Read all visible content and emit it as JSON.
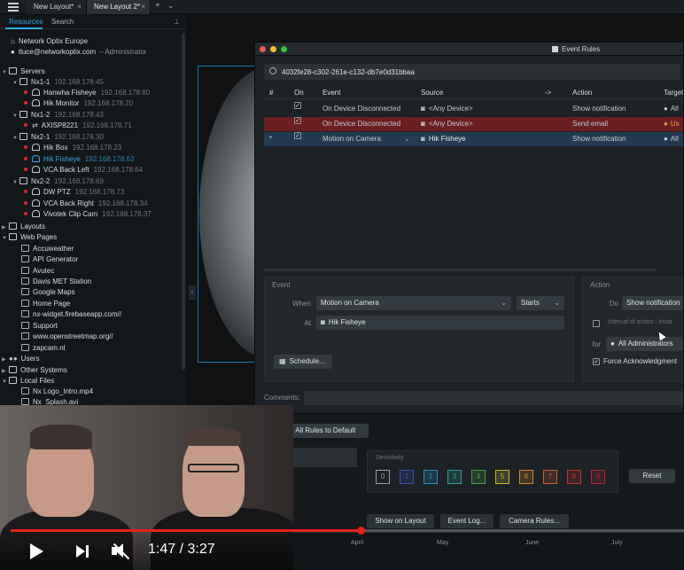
{
  "topbar": {
    "tabs": [
      {
        "label": "New Layout*"
      },
      {
        "label": "New Layout 2*"
      }
    ],
    "plus": "+",
    "chevron": "⌄",
    "close": "×"
  },
  "left_panel": {
    "tab_resources": "Resources",
    "tab_search": "Search",
    "system_name": "Network Optix Europe",
    "user_email": "tluce@networkoptix.com",
    "user_role": "– Administrator",
    "servers_label": "Servers",
    "tree": [
      {
        "name": "Nx1-1",
        "ip": "192.168.178.45"
      },
      {
        "name": "Hanwha Fisheye",
        "ip": "192.168.178.80"
      },
      {
        "name": "Hik Monitor",
        "ip": "192.168.178.20"
      },
      {
        "name": "Nx1-2",
        "ip": "192.168.178.43"
      },
      {
        "name": "AXISP8221",
        "ip": "192.168.178.71"
      },
      {
        "name": "Nx2-1",
        "ip": "192.168.178.30"
      },
      {
        "name": "Hik Box",
        "ip": "192.168.178.23"
      },
      {
        "name": "Hik Fisheye",
        "ip": "192.168.178.63"
      },
      {
        "name": "VCA Back Left",
        "ip": "192.168.178.64"
      },
      {
        "name": "Nx2-2",
        "ip": "192.168.178.69"
      },
      {
        "name": "DW PTZ",
        "ip": "192.168.178.73"
      },
      {
        "name": "VCA Back Right",
        "ip": "192.168.178.34"
      },
      {
        "name": "Vivotek Clip Cam",
        "ip": "192.168.178.37"
      }
    ],
    "layouts_label": "Layouts",
    "webpages_label": "Web Pages",
    "webpages": [
      "Accuweather",
      "API Generator",
      "Avutec",
      "Davis MET Station",
      "Google Maps",
      "Home Page",
      "nx-widget.firebaseapp.com//",
      "Support",
      "www.openstreetmap.org//",
      "zapcam.nl"
    ],
    "users_label": "Users",
    "other_systems_label": "Other Systems",
    "local_files_label": "Local Files",
    "local_files": [
      "Nx Logo_Intro.mp4",
      "Nx_Splash.avi"
    ]
  },
  "dialog": {
    "title": "Event Rules",
    "search_value": "4032fe28-c302-261e-c132-db7e0d31bbaa",
    "columns": {
      "num": "#",
      "on": "On",
      "event": "Event",
      "source": "Source",
      "arrow": "->",
      "action": "Action",
      "target": "Target"
    },
    "rules": [
      {
        "num": "",
        "event": "On Device Disconnected",
        "source": "<Any Device>",
        "action": "Show notification",
        "target": "All"
      },
      {
        "num": "",
        "event": "On Device Disconnected",
        "source": "<Any Device>",
        "action": "Send email",
        "target": "Us"
      },
      {
        "num": "*",
        "event": "Motion on Camera",
        "source": "Hik Fisheye",
        "action": "Show notification",
        "target": "All"
      }
    ],
    "event_panel": {
      "label": "Event",
      "when_label": "When",
      "when_value": "Motion on Camera",
      "starts_value": "Starts",
      "at_label": "At",
      "at_value": "Hik Fisheye",
      "schedule_button": "Schedule..."
    },
    "action_panel": {
      "label": "Action",
      "do_label": "Do",
      "do_value": "Show notification",
      "interval_label": "Interval of action :",
      "interval_value": "Insta",
      "for_label": "for",
      "for_value": "All Administrators",
      "force_ack_label": "Force Acknowledgment"
    },
    "comments_label": "Comments:"
  },
  "bottom": {
    "restore_button": "e All Rules to Default",
    "sensitivity_label": "Sensitivity",
    "sensitivity_levels": [
      "0",
      "1",
      "2",
      "3",
      "4",
      "5",
      "6",
      "7",
      "8",
      "9"
    ],
    "sensitivity_colors": [
      "#9aa2a6",
      "#3c4fb8",
      "#2a8fc9",
      "#27a39a",
      "#4aa148",
      "#c2b82b",
      "#d9892a",
      "#d25a2c",
      "#c7322f",
      "#b2263a"
    ],
    "reset_button": "Reset",
    "show_on_layout": "Show on Layout",
    "event_log": "Event Log...",
    "camera_rules": "Camera Rules...",
    "months": [
      "April",
      "May",
      "June",
      "July"
    ]
  },
  "player": {
    "time": "1:47 / 3:27",
    "progress_fraction": 0.52
  }
}
